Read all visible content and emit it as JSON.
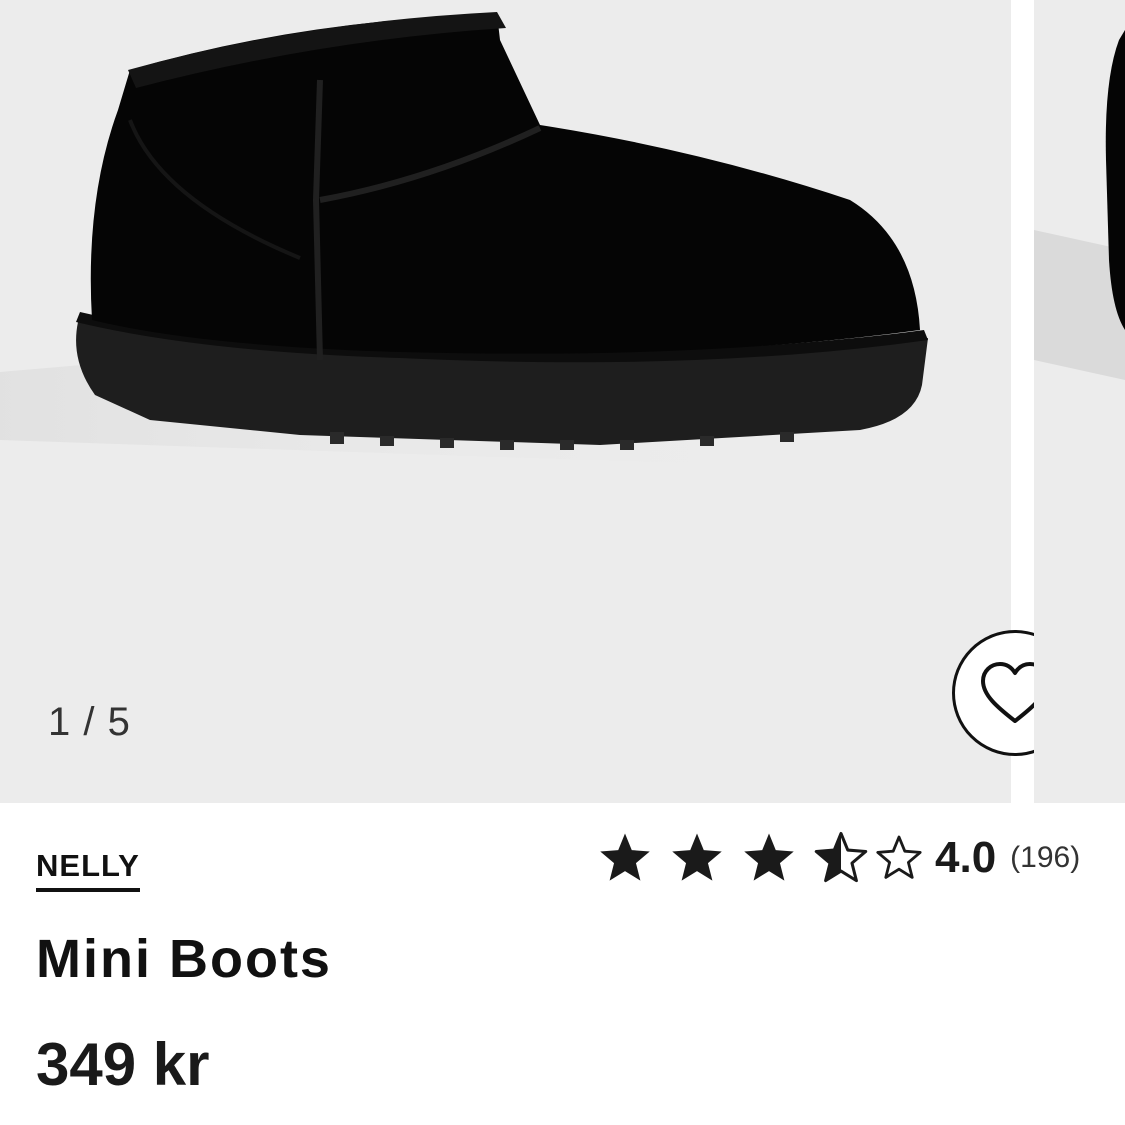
{
  "gallery": {
    "counter": "1 / 5",
    "background": "#ececec"
  },
  "wishlist": {
    "icon": "heart-icon"
  },
  "product": {
    "brand": "NELLY",
    "title": "Mini Boots",
    "price": "349 kr"
  },
  "rating": {
    "value": "4.0",
    "count": "(196)",
    "stars_filled": 3.5,
    "stars_total": 5
  }
}
